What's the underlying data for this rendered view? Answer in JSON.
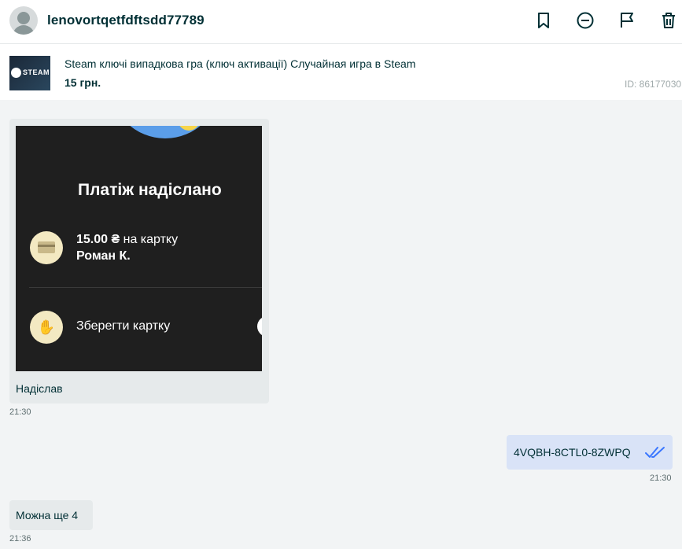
{
  "header": {
    "username": "lenovortqetfdftsdd77789",
    "icons": [
      "bookmark-icon",
      "minus-circle-icon",
      "flag-icon",
      "trash-icon"
    ]
  },
  "ad": {
    "thumb_text": "STEAM",
    "title": "Steam ключі випадкова гра (ключ активації) Случайная игра в Steam",
    "price": "15 грн.",
    "id": "ID: 86177030"
  },
  "messages": {
    "image_message": {
      "screenshot": {
        "title": "Платіж надіслано",
        "amount": "15.00 ₴",
        "amount_suffix": " на картку",
        "recipient": "Роман К.",
        "save_label": "Зберегти картку"
      },
      "caption": "Надіслав",
      "time": "21:30"
    },
    "outgoing": {
      "text": "4VQBH-8CTL0-8ZWPQ",
      "time": "21:30",
      "status": "read"
    },
    "incoming": {
      "text": "Можна ще 4",
      "time": "21:36"
    }
  },
  "colors": {
    "accent": "#002f34",
    "chat_bg": "#f2f4f5",
    "outgoing_bubble": "#d9e3f7",
    "incoming_bubble": "#e6eaeb",
    "read_ticks": "#3a77ff"
  }
}
